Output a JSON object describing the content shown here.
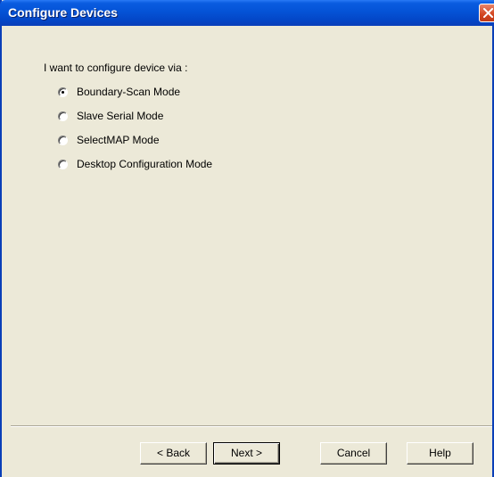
{
  "window": {
    "title": "Configure Devices"
  },
  "prompt": "I want to configure device via :",
  "options": [
    {
      "label": "Boundary-Scan Mode",
      "selected": true
    },
    {
      "label": "Slave Serial Mode",
      "selected": false
    },
    {
      "label": "SelectMAP Mode",
      "selected": false
    },
    {
      "label": "Desktop Configuration Mode",
      "selected": false
    }
  ],
  "buttons": {
    "back": "< Back",
    "next": "Next >",
    "cancel": "Cancel",
    "help": "Help"
  },
  "colors": {
    "titlebar": "#0453d6",
    "background": "#ece9d8",
    "close_button": "#d2451f"
  }
}
